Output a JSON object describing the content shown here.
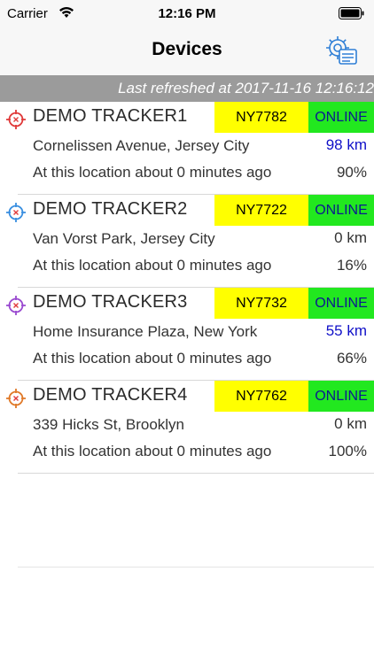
{
  "status_bar": {
    "carrier": "Carrier",
    "time": "12:16 PM"
  },
  "nav": {
    "title": "Devices",
    "settings_icon": "settings-gear-icon"
  },
  "refresh": {
    "text": "Last refreshed at 2017-11-16 12:16:12"
  },
  "colors": {
    "plate_bg": "#ffff00",
    "online_bg": "#22e81f",
    "online_text": "#0b1a8f",
    "distance_highlight": "#1010c8",
    "banner_bg": "#9b9b9b"
  },
  "devices": [
    {
      "name": "DEMO TRACKER1",
      "plate": "NY7782",
      "status": "ONLINE",
      "address": "Cornelissen Avenue, Jersey City",
      "distance": "98 km",
      "distance_highlight": true,
      "location_age": "At this location about 0 minutes ago",
      "battery": "90%",
      "icon_color": "#e03a3a"
    },
    {
      "name": "DEMO TRACKER2",
      "plate": "NY7722",
      "status": "ONLINE",
      "address": "Van Vorst Park, Jersey City",
      "distance": "0 km",
      "distance_highlight": false,
      "location_age": "At this location about 0 minutes ago",
      "battery": "16%",
      "icon_color": "#3a8fe0"
    },
    {
      "name": "DEMO TRACKER3",
      "plate": "NY7732",
      "status": "ONLINE",
      "address": "Home Insurance Plaza, New York",
      "distance": "55 km",
      "distance_highlight": true,
      "location_age": "At this location about 0 minutes ago",
      "battery": "66%",
      "icon_color": "#9a4ad0"
    },
    {
      "name": "DEMO TRACKER4",
      "plate": "NY7762",
      "status": "ONLINE",
      "address": "339 Hicks St, Brooklyn",
      "distance": "0 km",
      "distance_highlight": false,
      "location_age": "At this location about 0 minutes ago",
      "battery": "100%",
      "icon_color": "#e07a2a"
    }
  ]
}
